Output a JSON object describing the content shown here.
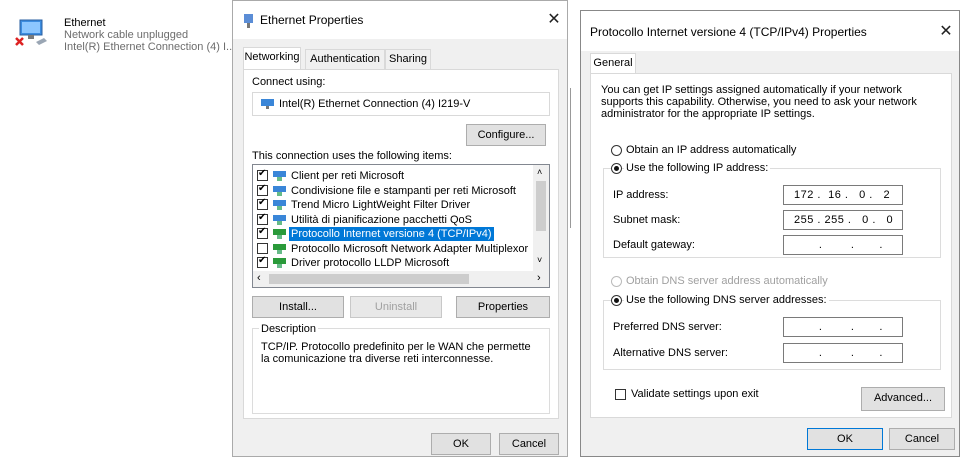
{
  "network_connection": {
    "title": "Ethernet",
    "status": "Network cable unplugged",
    "device": "Intel(R) Ethernet Connection (4) I..."
  },
  "ethernet_dialog": {
    "title": "Ethernet Properties",
    "tabs": [
      "Networking",
      "Authentication",
      "Sharing"
    ],
    "connect_using_label": "Connect using:",
    "adapter_name": "Intel(R) Ethernet Connection (4) I219-V",
    "configure_button": "Configure...",
    "items_label": "This connection uses the following items:",
    "items": [
      {
        "label": "Client per reti Microsoft",
        "checked": true,
        "selected": false
      },
      {
        "label": "Condivisione file e stampanti per reti Microsoft",
        "checked": true,
        "selected": false
      },
      {
        "label": "Trend Micro LightWeight Filter Driver",
        "checked": true,
        "selected": false
      },
      {
        "label": "Utilità di pianificazione pacchetti QoS",
        "checked": true,
        "selected": false
      },
      {
        "label": "Protocollo Internet versione 4 (TCP/IPv4)",
        "checked": true,
        "selected": true
      },
      {
        "label": "Protocollo Microsoft Network Adapter Multiplexor",
        "checked": false,
        "selected": false
      },
      {
        "label": "Driver protocollo LLDP Microsoft",
        "checked": true,
        "selected": false
      }
    ],
    "install_button": "Install...",
    "uninstall_button": "Uninstall",
    "properties_button": "Properties",
    "description_label": "Description",
    "description_text": "TCP/IP. Protocollo predefinito per le WAN che permette la comunicazione tra diverse reti interconnesse.",
    "ok_button": "OK",
    "cancel_button": "Cancel"
  },
  "ipv4_dialog": {
    "title": "Protocollo Internet versione 4 (TCP/IPv4) Properties",
    "tab": "General",
    "intro": "You can get IP settings assigned automatically if your network supports this capability. Otherwise, you need to ask your network administrator for the appropriate IP settings.",
    "obtain_ip_auto": "Obtain an IP address automatically",
    "use_following_ip": "Use the following IP address:",
    "ip_address_label": "IP address:",
    "ip_address_value": "172 .  16 .   0 .   2",
    "subnet_mask_label": "Subnet mask:",
    "subnet_mask_value": "255 . 255 .   0 .   0",
    "default_gateway_label": "Default gateway:",
    "default_gateway_value": "       .        .       .",
    "obtain_dns_auto": "Obtain DNS server address automatically",
    "use_following_dns": "Use the following DNS server addresses:",
    "preferred_dns_label": "Preferred DNS server:",
    "preferred_dns_value": "       .        .       .",
    "alternate_dns_label": "Alternative DNS server:",
    "alternate_dns_value": "       .        .       .",
    "validate_label": "Validate settings upon exit",
    "advanced_button": "Advanced...",
    "ok_button": "OK",
    "cancel_button": "Cancel"
  },
  "colors": {
    "selection": "#0078d7",
    "dialog_bg": "#f0f0f0",
    "disabled_text": "#a0a0a0"
  }
}
